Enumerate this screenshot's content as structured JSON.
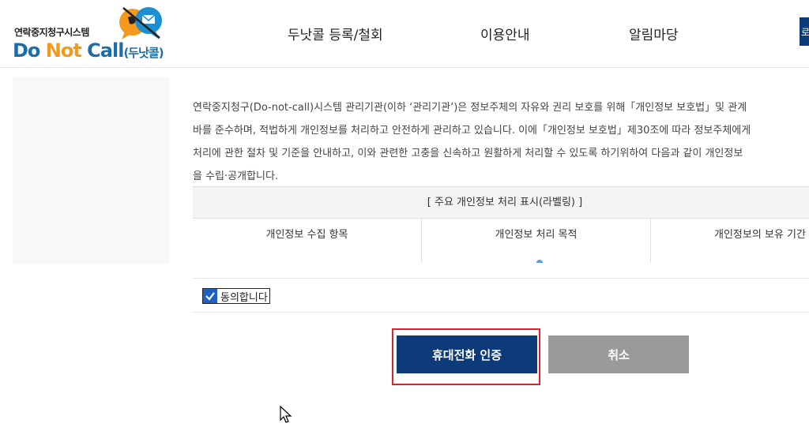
{
  "header": {
    "logo": {
      "subtitle": "연락중지청구시스템",
      "main_do": "Do ",
      "main_not": "Not",
      "main_call": " Call",
      "main_korean": "(두낫콜)"
    },
    "nav": {
      "item1": "두낫콜 등록/철회",
      "item2": "이용안내",
      "item3": "알림마당",
      "item4": "로"
    }
  },
  "intro": {
    "line1": "연락중지청구(Do-not-call)시스템 관리기관(이하 ‘관리기관’)은   정보주체의 자유와 권리 보호를 위해「개인정보 보호법」및 관계",
    "line2": "바를 준수하며, 적법하게 개인정보를 처리하고 안전하게 관리하고 있습니다. 이에「개인정보 보호법」제30조에 따라 정보주체에게",
    "line3": "처리에 관한 절차 및 기준을 안내하고, 이와 관련한 고충을 신속하고 원활하게 처리할 수 있도록 하기위하여 다음과 같이 개인정보",
    "line4": "을 수립·공개합니다."
  },
  "labeling": {
    "title": "[ 주요 개인정보 처리 표시(라벨링) ]",
    "col1": "개인정보 수집 항목",
    "col2": "개인정보 처리 목적",
    "col3": "개인정보의 보유 기간"
  },
  "agreement": {
    "checked": true,
    "label": "동의합니다"
  },
  "buttons": {
    "verify_label": "휴대전화 인증",
    "cancel_label": "취소"
  },
  "colors": {
    "primary": "#0d3a78",
    "cancel": "#9a9a9a",
    "highlight": "#d9232d",
    "logo_blue": "#1d6ea8",
    "logo_orange": "#f39a1e"
  }
}
